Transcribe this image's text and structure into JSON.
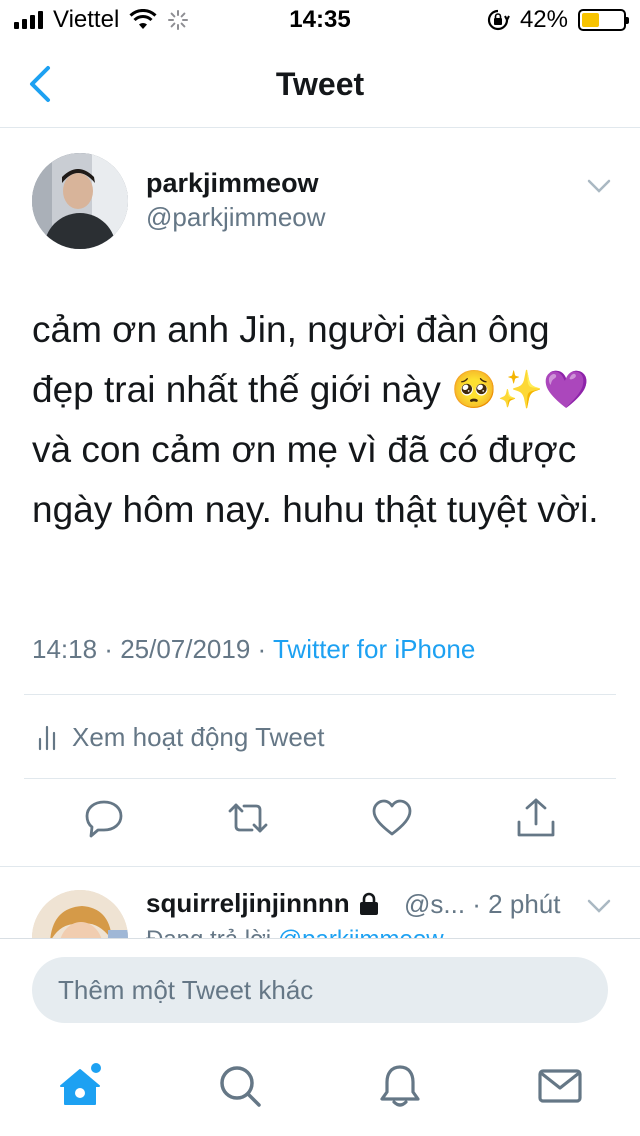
{
  "status_bar": {
    "carrier": "Viettel",
    "time": "14:35",
    "battery": "42%",
    "battery_level": 0.42,
    "signal_bars": 4
  },
  "nav": {
    "title": "Tweet",
    "back_icon": "chevron-left-icon"
  },
  "tweet": {
    "display_name": "parkjimmeow",
    "handle": "@parkjimmeow",
    "text_parts": [
      "cảm ơn anh Jin, người đàn ông đẹp trai nhất thế giới này ",
      "🥺✨💜",
      " và con cảm ơn mẹ vì đã có được ngày hôm nay. huhu thật tuyệt vời."
    ],
    "time": "14:18",
    "date": "25/07/2019",
    "separator": " · ",
    "source": "Twitter for iPhone",
    "activity_label": "Xem hoạt động Tweet"
  },
  "actions": [
    {
      "icon": "reply-icon"
    },
    {
      "icon": "retweet-icon"
    },
    {
      "icon": "like-icon"
    },
    {
      "icon": "share-icon"
    }
  ],
  "reply_preview": {
    "display_name": "squirreljinjinnnn",
    "meta": "@s... · 2 phút",
    "sub_prefix": "Đang trả lời ",
    "sub_link": "@parkjimmeow"
  },
  "composer": {
    "placeholder": "Thêm một Tweet khác"
  },
  "tab_bar": [
    {
      "icon": "home-icon",
      "active": true,
      "has_notification_dot": true
    },
    {
      "icon": "search-icon",
      "active": false
    },
    {
      "icon": "notifications-icon",
      "active": false
    },
    {
      "icon": "messages-icon",
      "active": false
    }
  ],
  "colors": {
    "accent": "#1da1f2",
    "secondary_text": "#657786",
    "battery_fill": "#f7c300"
  }
}
